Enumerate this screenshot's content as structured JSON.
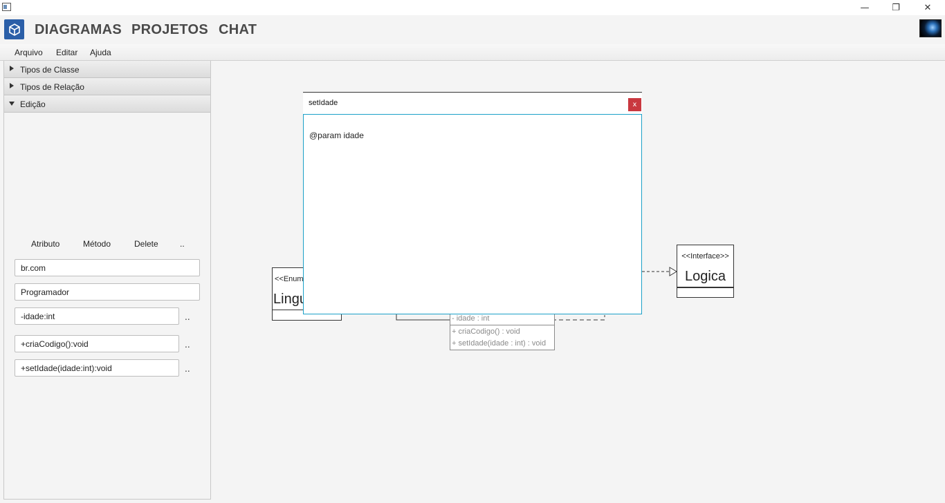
{
  "window": {
    "minimize_label": "—",
    "restore_label": "❐",
    "close_label": "✕"
  },
  "nav": {
    "items": [
      "DIAGRAMAS",
      "PROJETOS",
      "CHAT"
    ]
  },
  "menubar": {
    "items": [
      "Arquivo",
      "Editar",
      "Ajuda"
    ]
  },
  "sidebar": {
    "sections": [
      {
        "label": "Tipos de Classe",
        "expanded": false
      },
      {
        "label": "Tipos de Relação",
        "expanded": false
      },
      {
        "label": "Edição",
        "expanded": true
      }
    ],
    "tools": [
      "Atributo",
      "Método",
      "Delete",
      ".."
    ],
    "package_value": "br.com",
    "class_name_value": "Programador",
    "attributes": [
      "-idade:int"
    ],
    "methods": [
      "+criaCodigo():void",
      "+setIdade(idade:int):void"
    ],
    "more_label": ".."
  },
  "canvas": {
    "enum_box": {
      "stereotype": "<<Enum",
      "name": "Lingu"
    },
    "interface_box": {
      "stereotype": "<<Interface>>",
      "name": "Logica"
    },
    "class_box": {
      "attributes": [
        "- idade : int"
      ],
      "methods": [
        "+ criaCodigo() : void",
        "+ setIdade(idade : int) : void"
      ]
    }
  },
  "dialog": {
    "title": "setIdade",
    "close_label": "x",
    "body_text": "@param idade"
  },
  "colors": {
    "logo_bg": "#2b5fa8",
    "close_btn": "#c9383f",
    "focus_border": "#1aa0c8"
  }
}
